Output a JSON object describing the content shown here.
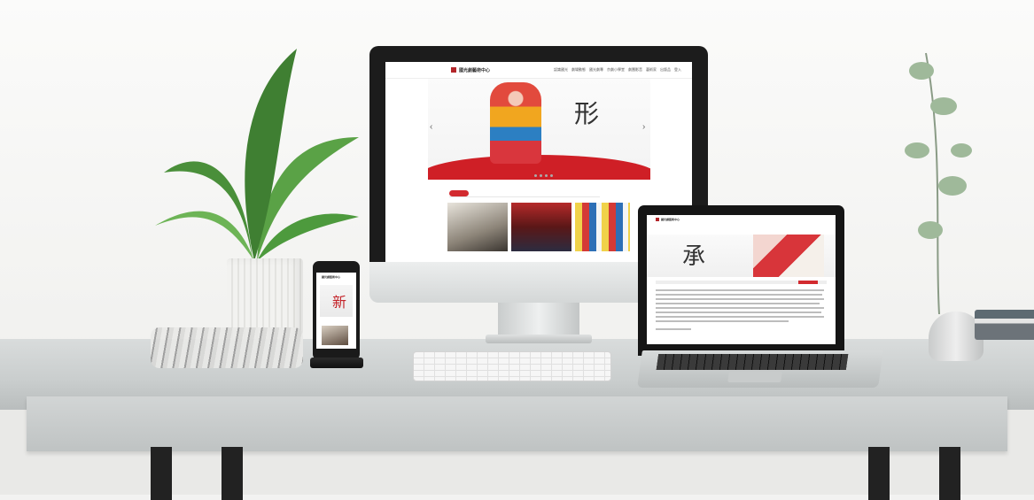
{
  "scene": "desk mockup with iMac, laptop and phone",
  "imac": {
    "logo_text": "國光劇藝術中心",
    "nav_items": [
      "認識國光",
      "劇場動態",
      "國光劇專",
      "京劇小學堂",
      "劇團影音",
      "藝術家",
      "出版品",
      "登入"
    ],
    "banner_calligraphy": "形",
    "tab_label": "最新消息",
    "arrow_left": "‹",
    "arrow_right": "›"
  },
  "laptop": {
    "logo_text": "國光劇藝術中心",
    "banner_calligraphy": "承"
  },
  "phone": {
    "logo_text": "國光劇藝術中心",
    "banner_calligraphy": "新"
  },
  "colors": {
    "accent_red": "#cf1f26",
    "desk": "#c9cdcd",
    "wall": "#f7f7f6"
  }
}
